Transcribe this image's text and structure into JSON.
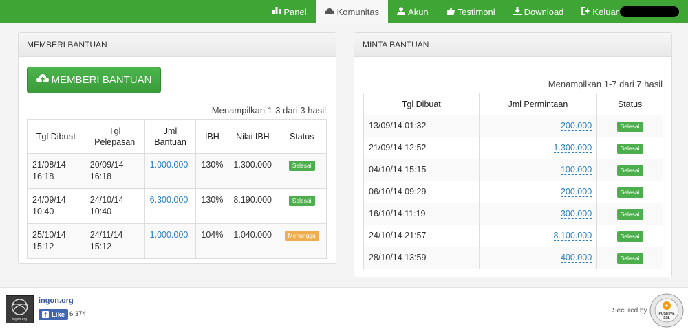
{
  "nav": {
    "items": [
      {
        "label": "Panel",
        "icon": "bar-chart-icon"
      },
      {
        "label": "Komunitas",
        "icon": "cloud-icon",
        "active": true
      },
      {
        "label": "Akun",
        "icon": "user-icon"
      },
      {
        "label": "Testimoni",
        "icon": "thumbs-up-icon"
      },
      {
        "label": "Download",
        "icon": "download-icon"
      },
      {
        "label": "Keluar",
        "icon": "logout-icon"
      }
    ]
  },
  "left_panel": {
    "title": "MEMBERI BANTUAN",
    "button_label": "MEMBERI BANTUAN",
    "result_text": "Menampilkan 1-3 dari 3 hasil",
    "columns": [
      "Tgl Dibuat",
      "Tgl Pelepasan",
      "Jml Bantuan",
      "IBH",
      "Nilai IBH",
      "Status"
    ],
    "rows": [
      {
        "created_date": "21/08/14",
        "created_time": "16:18",
        "release_date": "20/09/14",
        "release_time": "16:18",
        "amount": "1.000.000",
        "ibh": "130%",
        "ibh_value": "1.300.000",
        "status": "Selesai",
        "status_type": "done"
      },
      {
        "created_date": "24/09/14",
        "created_time": "10:40",
        "release_date": "24/10/14",
        "release_time": "10:40",
        "amount": "6.300.000",
        "ibh": "130%",
        "ibh_value": "8.190.000",
        "status": "Selesai",
        "status_type": "done"
      },
      {
        "created_date": "25/10/14",
        "created_time": "15:12",
        "release_date": "24/11/14",
        "release_time": "15:12",
        "amount": "1.000.000",
        "ibh": "104%",
        "ibh_value": "1.040.000",
        "status": "Menunggu",
        "status_type": "wait"
      }
    ]
  },
  "right_panel": {
    "title": "MINTA BANTUAN",
    "result_text": "Menampilkan 1-7 dari 7 hasil",
    "columns": [
      "Tgl Dibuat",
      "Jml Permintaan",
      "Status"
    ],
    "rows": [
      {
        "created": "13/09/14 01:32",
        "amount": "200.000",
        "status": "Selesai"
      },
      {
        "created": "21/09/14 12:52",
        "amount": "1.300.000",
        "status": "Selesai"
      },
      {
        "created": "04/10/14 15:15",
        "amount": "100.000",
        "status": "Selesai"
      },
      {
        "created": "06/10/14 09:29",
        "amount": "200.000",
        "status": "Selesai"
      },
      {
        "created": "16/10/14 11:19",
        "amount": "300.000",
        "status": "Selesai"
      },
      {
        "created": "24/10/14 21:57",
        "amount": "8.100.000",
        "status": "Selesai"
      },
      {
        "created": "28/10/14 13:59",
        "amount": "400.000",
        "status": "Selesai"
      }
    ]
  },
  "footer": {
    "site_name": "ingon.org",
    "logo_caption": "ingon.org",
    "like_label": "Like",
    "like_count": "6,374",
    "secured_by": "Secured by",
    "ssl_text": "POSITIVE SSL"
  },
  "colors": {
    "brand_green": "#3fa534",
    "link_blue": "#2a7fc8",
    "status_done": "#4cae4c",
    "status_wait": "#f0ad4e"
  }
}
